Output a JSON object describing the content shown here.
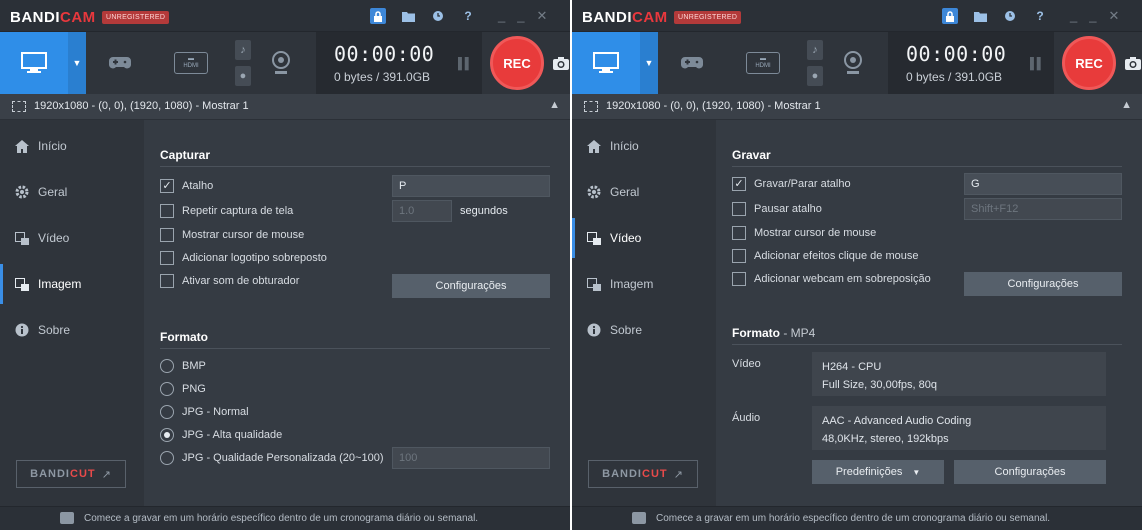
{
  "app": {
    "brand_primary": "BANDI",
    "brand_accent": "CAM",
    "unregistered_badge": "UNREGISTERED",
    "timer": "00:00:00",
    "size": "0 bytes / 391.0GB",
    "rec_label": "REC",
    "target": "1920x1080 - (0, 0), (1920, 1080) - Mostrar 1",
    "hdmi_label": "HDMI",
    "footer_text": "Comece a gravar em um horário específico dentro de um cronograma diário ou semanal.",
    "bandicut_primary": "BANDI",
    "bandicut_accent": "CUT",
    "bandicut_arrow": "↗",
    "nav": {
      "inicio": "Início",
      "geral": "Geral",
      "video": "Vídeo",
      "imagem": "Imagem",
      "sobre": "Sobre"
    }
  },
  "colors": {
    "accent_blue": "#2f8ee8",
    "rec_red": "#e83b3b",
    "window_bg": "#353b43"
  },
  "left_window": {
    "active_tab": "imagem",
    "capture": {
      "title": "Capturar",
      "hotkey_label": "Atalho",
      "hotkey_checked": true,
      "hotkey_value": "P",
      "repeat_label": "Repetir captura de tela",
      "repeat_checked": false,
      "repeat_value": "1.0",
      "repeat_unit": "segundos",
      "cursor_label": "Mostrar cursor de mouse",
      "cursor_checked": false,
      "logo_label": "Adicionar logotipo sobreposto",
      "logo_checked": false,
      "shutter_label": "Ativar som de obturador",
      "shutter_checked": false,
      "settings_button": "Configurações"
    },
    "format": {
      "title": "Formato",
      "options": [
        {
          "label": "BMP",
          "selected": false
        },
        {
          "label": "PNG",
          "selected": false
        },
        {
          "label": "JPG - Normal",
          "selected": false
        },
        {
          "label": "JPG - Alta qualidade",
          "selected": true
        },
        {
          "label": "JPG - Qualidade Personalizada (20~100)",
          "selected": false
        }
      ],
      "custom_quality_value": "100"
    }
  },
  "right_window": {
    "active_tab": "video",
    "record": {
      "title": "Gravar",
      "start_stop_label": "Gravar/Parar atalho",
      "start_stop_checked": true,
      "start_stop_value": "G",
      "pause_label": "Pausar atalho",
      "pause_checked": false,
      "pause_value": "Shift+F12",
      "cursor_label": "Mostrar cursor de mouse",
      "cursor_checked": false,
      "click_effects_label": "Adicionar efeitos clique de mouse",
      "click_effects_checked": false,
      "webcam_label": "Adicionar webcam em sobreposição",
      "webcam_checked": false,
      "settings_button": "Configurações"
    },
    "format": {
      "title": "Formato",
      "container": "MP4",
      "video_label": "Vídeo",
      "video_codec": "H264 - CPU",
      "video_details": "Full Size, 30,00fps, 80q",
      "audio_label": "Áudio",
      "audio_codec": "AAC - Advanced Audio Coding",
      "audio_details": "48,0KHz, stereo, 192kbps",
      "presets_button": "Predefinições",
      "settings_button": "Configurações"
    }
  }
}
